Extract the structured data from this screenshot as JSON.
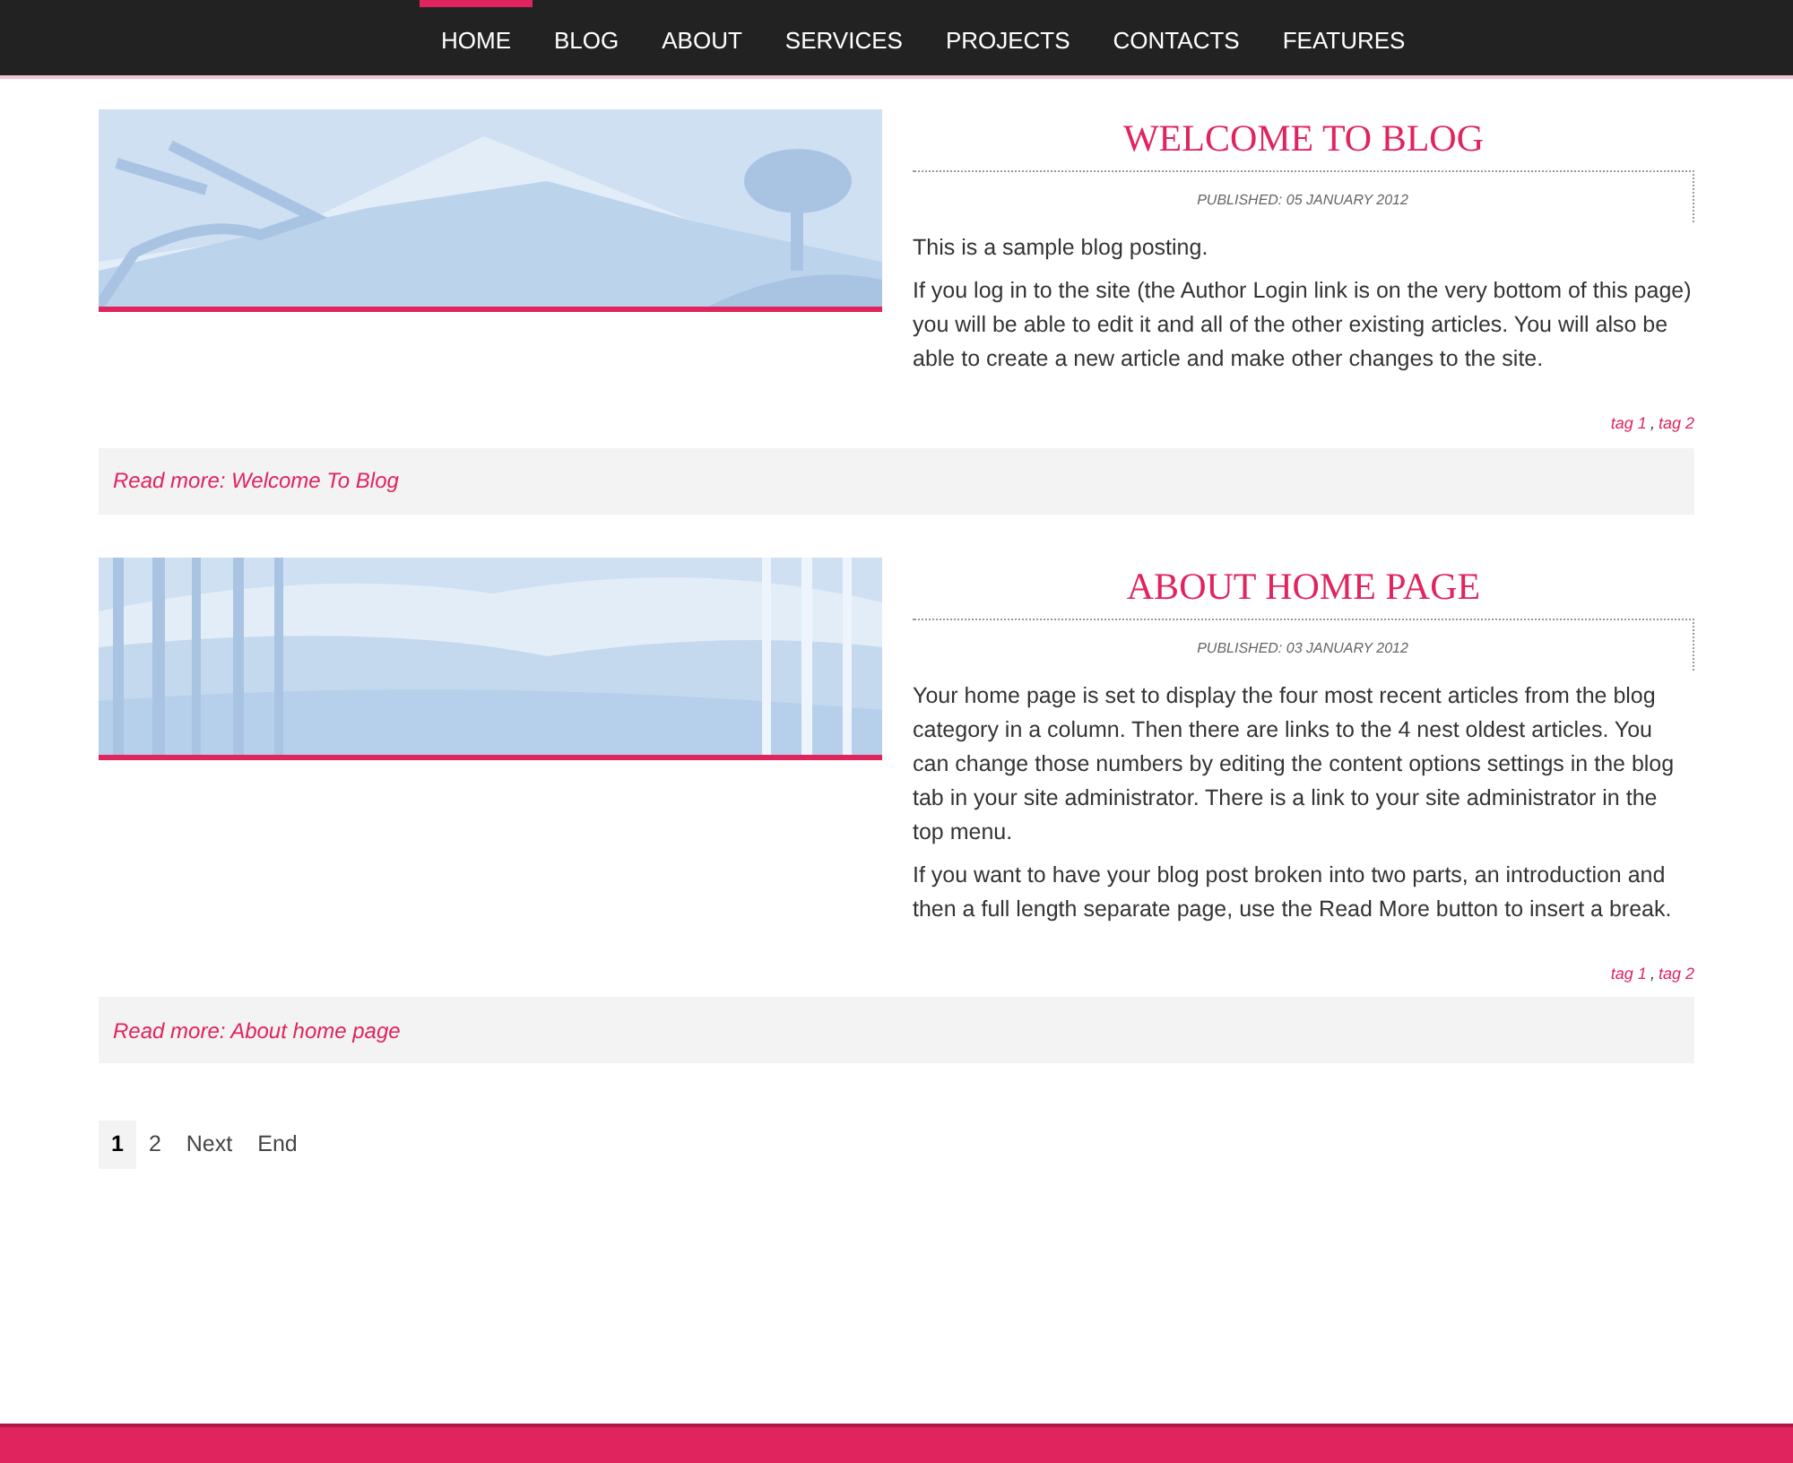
{
  "nav": [
    {
      "label": "HOME",
      "selected": true
    },
    {
      "label": "BLOG",
      "selected": false
    },
    {
      "label": "ABOUT",
      "selected": false
    },
    {
      "label": "SERVICES",
      "selected": false
    },
    {
      "label": "PROJECTS",
      "selected": false
    },
    {
      "label": "CONTACTS",
      "selected": false
    },
    {
      "label": "FEATURES",
      "selected": false
    }
  ],
  "articles": [
    {
      "kind": "mountain",
      "title": "WELCOME TO BLOG",
      "published": "PUBLISHED: 05 JANUARY 2012",
      "paragraphs": [
        "This is a sample blog posting.",
        "If you log in to the site (the Author Login link is on the very bottom of this page) you will be able to edit it and all of the other existing articles. You will also be able to create a new article and make other changes to the site."
      ],
      "tags": [
        "tag 1",
        "tag 2"
      ],
      "tag_separator": ",",
      "read_more": "Read more: Welcome To Blog"
    },
    {
      "kind": "bamboo",
      "title": "ABOUT HOME PAGE",
      "published": "PUBLISHED: 03 JANUARY 2012",
      "paragraphs": [
        "Your home page is set to display the four most recent articles from the blog category in a column. Then there are links to the 4 nest oldest articles. You can change those numbers by editing the content options settings in the blog tab in your site administrator. There is a link to your site administrator in the top menu.",
        "If you want to have your blog post broken into two parts, an introduction and then a full length separate page, use the Read More button to insert a break."
      ],
      "tags": [
        "tag 1",
        "tag 2"
      ],
      "tag_separator": ",",
      "read_more": "Read more: About home page"
    }
  ],
  "pagination": [
    {
      "label": "1",
      "selected": true
    },
    {
      "label": "2",
      "selected": false
    },
    {
      "label": "Next",
      "selected": false
    },
    {
      "label": "End",
      "selected": false
    }
  ]
}
